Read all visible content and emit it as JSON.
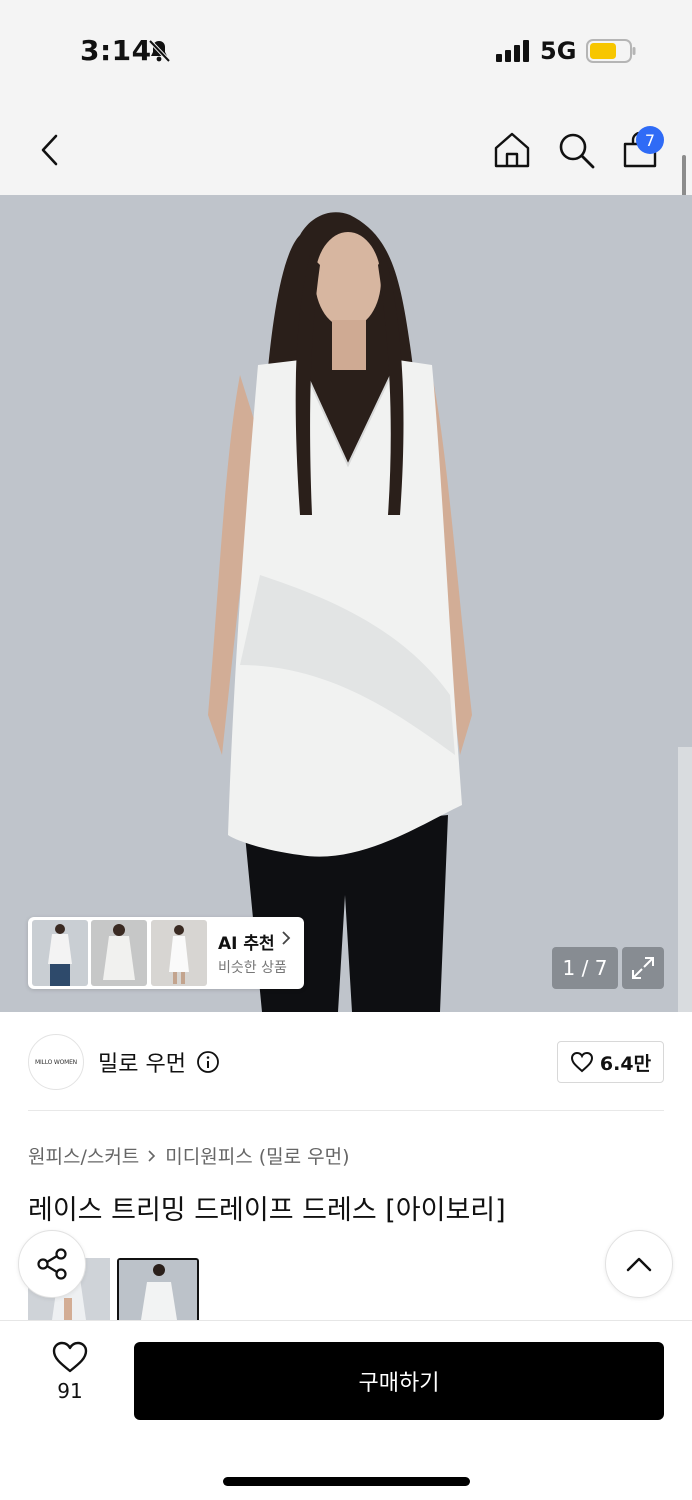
{
  "status": {
    "time": "3:14",
    "network": "5G",
    "colors": {
      "battery": "#f7c600",
      "badge": "#2f6bf6"
    },
    "icons": [
      "bell-slash-icon",
      "signal-icon",
      "battery-icon"
    ]
  },
  "header": {
    "cart_count": "7",
    "icons": [
      "back-icon",
      "home-icon",
      "search-icon",
      "shopping-bag-icon"
    ]
  },
  "gallery": {
    "counter": "1 / 7",
    "ai_title": "AI 추천",
    "ai_subtitle": "비슷한 상품"
  },
  "brand": {
    "logo_text": "MILLO WOMEN",
    "name": "밀로 우먼",
    "likes": "6.4만"
  },
  "product": {
    "breadcrumb": [
      "원피스/스커트",
      "미디원피스 (밀로 우먼)"
    ],
    "title": "레이스 트리밍 드레이프 드레스 [아이보리]"
  },
  "bottom": {
    "wish_count": "91",
    "buy_label": "구매하기"
  }
}
